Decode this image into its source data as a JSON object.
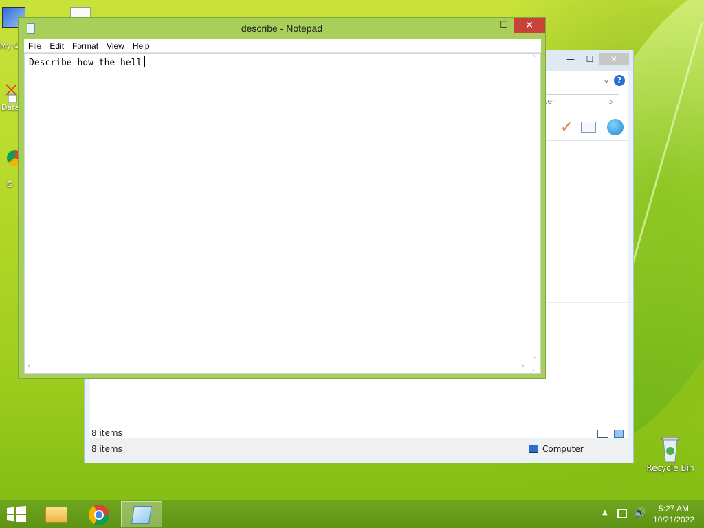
{
  "desktop": {
    "icons": [
      {
        "label": "My C"
      },
      {
        "label": "Data"
      },
      {
        "label": "G"
      },
      {
        "label": "Recycle Bin"
      }
    ]
  },
  "explorer": {
    "search_placeholder": "puter",
    "inner_status": "8 items",
    "status_items": "8 items",
    "status_location": "Computer",
    "controls": {
      "minimize": "—",
      "maximize": "☐",
      "close": "✕"
    }
  },
  "notepad": {
    "title": "describe - Notepad",
    "menu": [
      "File",
      "Edit",
      "Format",
      "View",
      "Help"
    ],
    "content": "Describe how the hell",
    "controls": {
      "minimize": "—",
      "maximize": "☐",
      "close": "✕"
    }
  },
  "taskbar": {
    "apps": [
      "file-explorer",
      "chrome",
      "notepad"
    ],
    "active_app": "notepad"
  },
  "clock": {
    "time": "5:27 AM",
    "date": "10/21/2022"
  },
  "colors": {
    "notepad_frame": "#a8cf5a",
    "close_button": "#c9423a",
    "taskbar": "#6fa51d"
  }
}
